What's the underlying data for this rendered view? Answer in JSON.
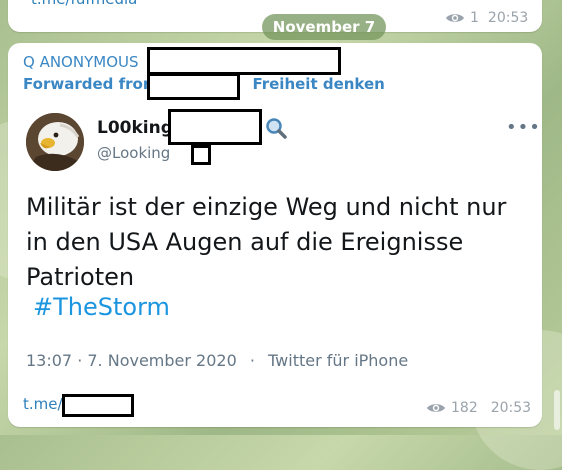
{
  "previous_message": {
    "link": "t.me/fufmedia",
    "views": "1",
    "time": "20:53"
  },
  "date_pill": "November 7",
  "message": {
    "sender": "Q ANONYMOUS",
    "forwarded_prefix": "Forwarded from",
    "forwarded_suffix": "Freiheit denken",
    "tweet": {
      "display_name_prefix": "L00king",
      "handle_prefix": "@Looking",
      "more_icon": "•••",
      "text": "Militär ist der einzige Weg und nicht nur in den USA Augen auf die Ereignisse Patrioten",
      "hashtag": "#TheStorm",
      "timestamp": "13:07 · 7. November 2020",
      "separator": "·",
      "client": "Twitter für iPhone"
    },
    "link_prefix": "t.me/",
    "views": "182",
    "time": "20:53"
  },
  "colors": {
    "link": "#2f7fb9",
    "sender": "#3a87c4",
    "hashtag": "#1b95e0",
    "meta": "#9aa3ab",
    "date_pill": "#76965c"
  },
  "icons": [
    "eye-icon",
    "magnifier-icon",
    "more-icon"
  ]
}
